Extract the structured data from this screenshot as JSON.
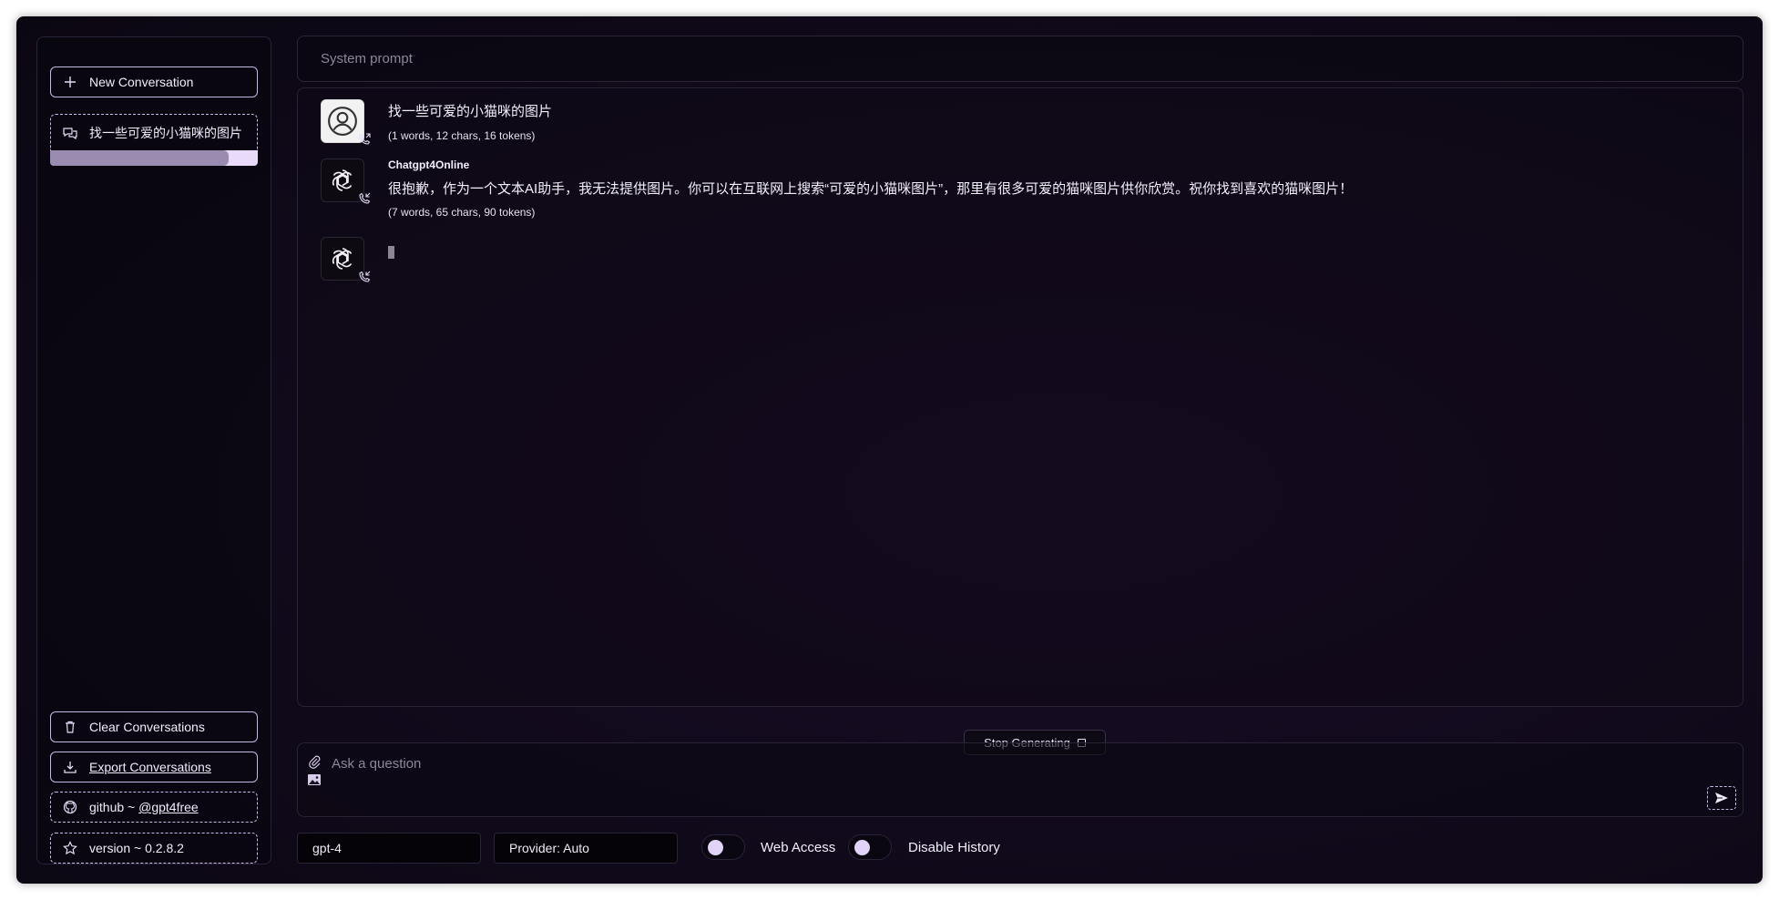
{
  "sidebar": {
    "new_conversation_label": "New Conversation",
    "conversations": [
      {
        "title": "找一些可爱的小猫咪的图片",
        "progress_fraction": 0.86
      }
    ],
    "clear_label": "Clear Conversations",
    "export_label": "Export Conversations",
    "github_prefix": "github ~ ",
    "github_link": "@gpt4free",
    "version_label": "version ~ 0.2.8.2"
  },
  "system_prompt": {
    "placeholder": "System prompt"
  },
  "messages": [
    {
      "role": "user",
      "text": "找一些可爱的小猫咪的图片",
      "meta": "(1 words, 12 chars, 16 tokens)"
    },
    {
      "role": "assistant",
      "provider": "Chatgpt4Online",
      "text": "很抱歉，作为一个文本AI助手，我无法提供图片。你可以在互联网上搜索“可爱的小猫咪图片”，那里有很多可爱的猫咪图片供你欣赏。祝你找到喜欢的猫咪图片！",
      "meta": "(7 words, 65 chars, 90 tokens)"
    },
    {
      "role": "assistant",
      "text": ""
    }
  ],
  "stop_generating_label": "Stop Generating",
  "input": {
    "placeholder": "Ask a question"
  },
  "footer": {
    "model": "gpt-4",
    "provider": "Provider: Auto",
    "web_access_label": "Web Access",
    "disable_history_label": "Disable History"
  },
  "icons": [
    "plus-icon",
    "chat-bubbles-icon",
    "trash-icon",
    "download-icon",
    "github-icon",
    "star-icon",
    "user-icon",
    "openai-logo-icon",
    "phone-call-icon",
    "paperclip-icon",
    "image-icon",
    "send-icon"
  ],
  "colors": {
    "accent": "#c9b7ea",
    "background": "#120a1d",
    "toggle_knob": "#e2d4f8"
  }
}
